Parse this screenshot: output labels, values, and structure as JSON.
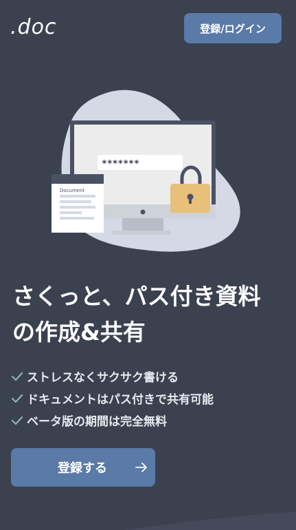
{
  "header": {
    "logo": ".doc",
    "login_button": "登録/ログイン"
  },
  "hero": {
    "password_placeholder": "*******",
    "document_label": "Document"
  },
  "headline": {
    "line1": "さくっと、パス付き資料",
    "line2": "の作成&共有"
  },
  "features": [
    {
      "text": "ストレスなくサクサク書ける",
      "icon": "check-icon"
    },
    {
      "text": "ドキュメントはパス付きで共有可能",
      "icon": "check-icon"
    },
    {
      "text": "ベータ版の期間は完全無料",
      "icon": "check-icon"
    }
  ],
  "cta": {
    "label": "登録する",
    "icon": "arrow-right-icon"
  },
  "colors": {
    "background": "#3c4150",
    "accent": "#5a7aa8",
    "blob": "#d5d9e6",
    "lock": "#e8c07a",
    "check": "#8fb3b8"
  }
}
